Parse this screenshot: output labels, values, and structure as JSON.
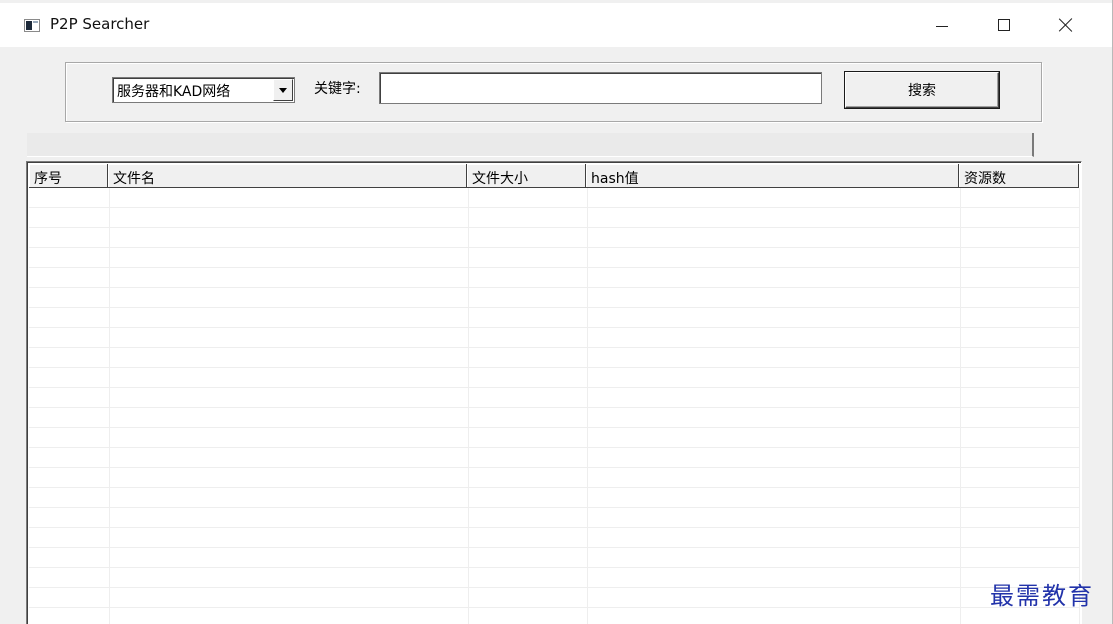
{
  "window": {
    "title": "P2P Searcher",
    "accent_color": "#4a90e2"
  },
  "search": {
    "network_selected": "服务器和KAD网络",
    "keyword_label": "关键字:",
    "keyword_value": "",
    "button_label": "搜索"
  },
  "results": {
    "columns": [
      "序号",
      "文件名",
      "文件大小",
      "hash值",
      "资源数"
    ],
    "rows": []
  },
  "watermark": "最需教育"
}
